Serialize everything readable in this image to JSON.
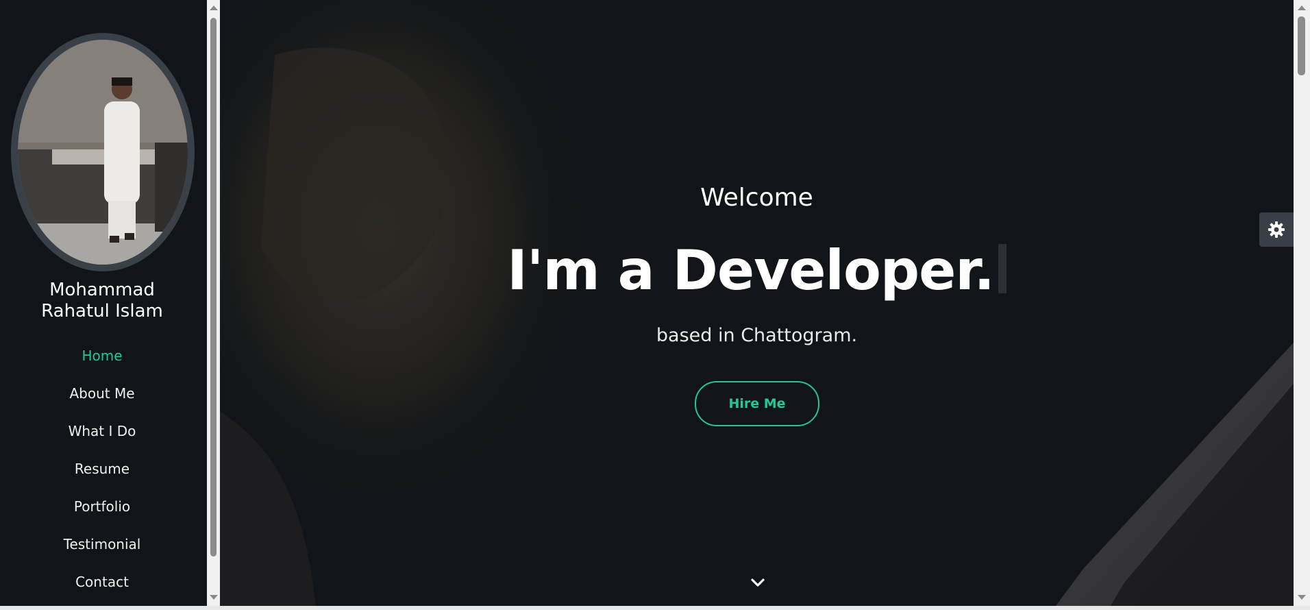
{
  "sidebar": {
    "owner_name_line1": "Mohammad",
    "owner_name_line2": "Rahatul Islam",
    "nav": [
      {
        "label": "Home",
        "active": true
      },
      {
        "label": "About Me",
        "active": false
      },
      {
        "label": "What I Do",
        "active": false
      },
      {
        "label": "Resume",
        "active": false
      },
      {
        "label": "Portfolio",
        "active": false
      },
      {
        "label": "Testimonial",
        "active": false
      },
      {
        "label": "Contact",
        "active": false
      }
    ]
  },
  "hero": {
    "welcome": "Welcome",
    "headline": "I'm a Developer.",
    "subtitle": "based in Chattogram.",
    "cta_label": "Hire Me",
    "scroll_icon": "chevron-down-icon"
  },
  "widgets": {
    "settings_icon": "gear-icon"
  },
  "colors": {
    "accent": "#20c997",
    "background": "#111418",
    "text": "#ffffff"
  }
}
